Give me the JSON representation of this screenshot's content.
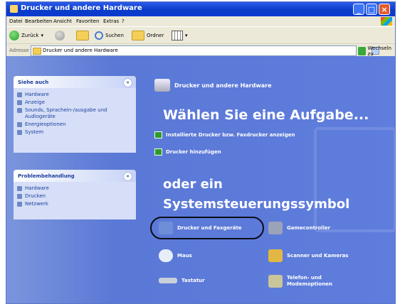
{
  "window": {
    "title": "Drucker und andere Hardware"
  },
  "menu": [
    "Datei",
    "Bearbeiten",
    "Ansicht",
    "Favoriten",
    "Extras",
    "?"
  ],
  "toolbar": {
    "back": "Zurück",
    "search": "Suchen",
    "folders": "Ordner"
  },
  "address": {
    "label": "Adresse",
    "value": "Drucker und andere Hardware",
    "go": "Wechseln zu"
  },
  "sidebar": {
    "see_also": {
      "title": "Siehe auch",
      "items": [
        "Hardware",
        "Anzeige",
        "Sounds, Sprachein-/ausgabe und Audiogeräte",
        "Energieoptionen",
        "System"
      ]
    },
    "troubleshoot": {
      "title": "Problembehandlung",
      "items": [
        "Hardware",
        "Drucken",
        "Netzwerk"
      ]
    }
  },
  "main": {
    "header": "Drucker und andere Hardware",
    "choose_task": "Wählen Sie eine Aufgabe...",
    "tasks": [
      "Installierte Drucker bzw. Faxdrucker anzeigen",
      "Drucker hinzufügen"
    ],
    "or_a": "oder ein",
    "cp_icon": "Systemsteuerungssymbol",
    "icons": [
      {
        "label": "Drucker und Faxgeräte",
        "color": "#6e8fd8"
      },
      {
        "label": "Gamecontroller",
        "color": "#9aa3b8"
      },
      {
        "label": "Maus",
        "color": "#e8eef8"
      },
      {
        "label": "Scanner und Kameras",
        "color": "#e2b744"
      },
      {
        "label": "Tastatur",
        "color": "#c9d0da"
      },
      {
        "label": "Telefon- und Modemoptionen",
        "color": "#c9c49a"
      }
    ]
  }
}
